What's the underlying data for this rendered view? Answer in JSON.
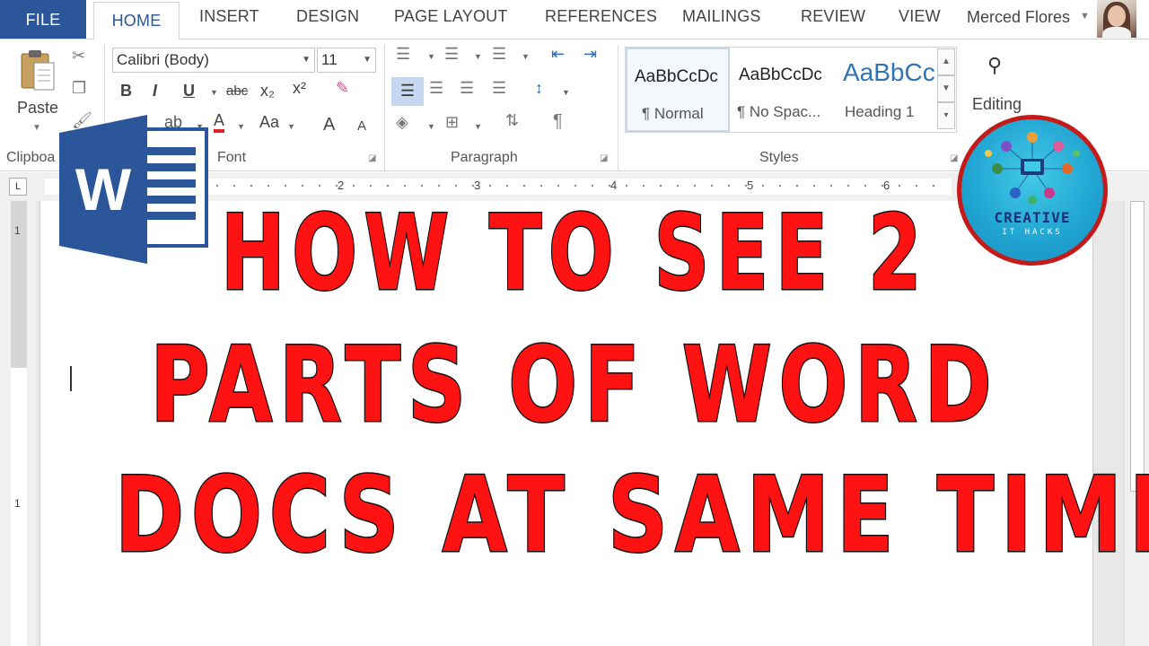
{
  "tabs": {
    "file": "FILE",
    "home": "HOME",
    "insert": "INSERT",
    "design": "DESIGN",
    "page_layout": "PAGE LAYOUT",
    "references": "REFERENCES",
    "mailings": "MAILINGS",
    "review": "REVIEW",
    "view": "VIEW"
  },
  "user": {
    "name": "Merced Flores"
  },
  "clipboard": {
    "paste_label": "Paste",
    "group_label": "Clipboa"
  },
  "font": {
    "family": "Calibri (Body)",
    "size": "11",
    "bold": "B",
    "italic": "I",
    "underline": "U",
    "strikethrough": "abc",
    "subscript": "x₂",
    "superscript": "x²",
    "change_case": "Aa",
    "grow": "A",
    "shrink": "A",
    "group_label": "Font"
  },
  "paragraph": {
    "group_label": "Paragraph",
    "pilcrow": "¶"
  },
  "styles": {
    "group_label": "Styles",
    "items": [
      {
        "sample": "AaBbCcDc",
        "name": "¶ Normal"
      },
      {
        "sample": "AaBbCcDc",
        "name": "¶ No Spac..."
      },
      {
        "sample": "AaBbCc",
        "name": "Heading 1"
      }
    ]
  },
  "editing": {
    "label": "Editing"
  },
  "ruler": {
    "tab_glyph": "L",
    "numbers": [
      "2",
      "3",
      "4",
      "5",
      "6"
    ],
    "vnumbers": [
      "1",
      "1"
    ]
  },
  "headline": {
    "line1": "HOW TO SEE 2",
    "line2": "PARTS OF WORD",
    "line3": "DOCS AT SAME TIME"
  },
  "badge": {
    "title": "CREATIVE",
    "subtitle": "IT HACKS"
  },
  "colors": {
    "word_blue": "#2b579a",
    "headline_red": "#ff1212",
    "badge_blue": "#1fa3d1",
    "badge_ring": "#c41a1a"
  }
}
